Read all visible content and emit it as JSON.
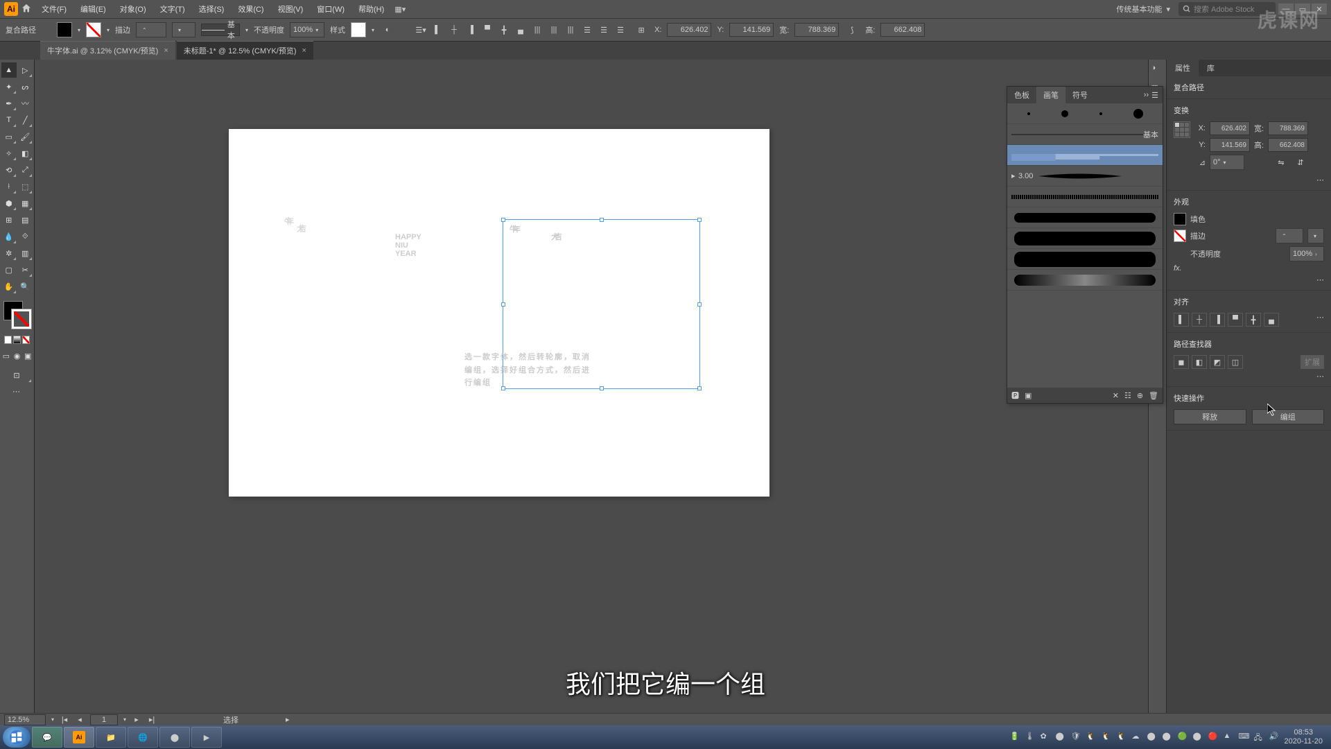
{
  "menubar": {
    "items": [
      "文件(F)",
      "编辑(E)",
      "对象(O)",
      "文字(T)",
      "选择(S)",
      "效果(C)",
      "视图(V)",
      "窗口(W)",
      "帮助(H)"
    ],
    "workspace": "传统基本功能",
    "stock_placeholder": "搜索 Adobe Stock"
  },
  "controlbar": {
    "sel_type": "复合路径",
    "stroke_label": "描边",
    "stroke_unit": "",
    "profile": "基本",
    "opacity_label": "不透明度",
    "opacity": "100%",
    "style_label": "样式",
    "x_label": "X:",
    "x": "626.402",
    "y_label": "Y:",
    "y": "141.569",
    "w_label": "宽:",
    "w": "788.369",
    "h_label": "高:",
    "h": "662.408"
  },
  "tabs": [
    {
      "label": "牛字体.ai @ 3.12% (CMYK/预览)",
      "active": false
    },
    {
      "label": "未标题-1* @ 12.5% (CMYK/预览)",
      "active": true
    }
  ],
  "canvas": {
    "calli_r1": "牛年",
    "calli_r2": "大吉",
    "happy": [
      "HAPPY",
      "NIU",
      "YEAR"
    ],
    "red_lines": [
      "选一款字体，然后转轮廓，取消",
      "编组，选择好组合方式，然后进",
      "行编组"
    ]
  },
  "brush_panel": {
    "tabs": [
      "色板",
      "画笔",
      "符号"
    ],
    "basic": "基本",
    "size": "3.00"
  },
  "props": {
    "tabs": [
      "属性",
      "库"
    ],
    "obj_type": "复合路径",
    "transform_title": "变换",
    "x": "626.402",
    "y": "141.569",
    "w": "788.369",
    "h": "662.408",
    "angle": "0°",
    "appearance_title": "外观",
    "fill_label": "填色",
    "stroke_label": "描边",
    "opacity_label": "不透明度",
    "opacity": "100%",
    "align_title": "对齐",
    "pathfinder_title": "路径查找器",
    "quick_title": "快速操作",
    "btn_release": "释放",
    "btn_edit": "编组"
  },
  "subtitle": "我们把它编一个组",
  "statusbar": {
    "zoom": "12.5%",
    "artboard": "1",
    "tool": "选择"
  },
  "taskbar": {
    "time": "08:53",
    "date": "2020-11-20"
  },
  "watermark": "虎课网"
}
